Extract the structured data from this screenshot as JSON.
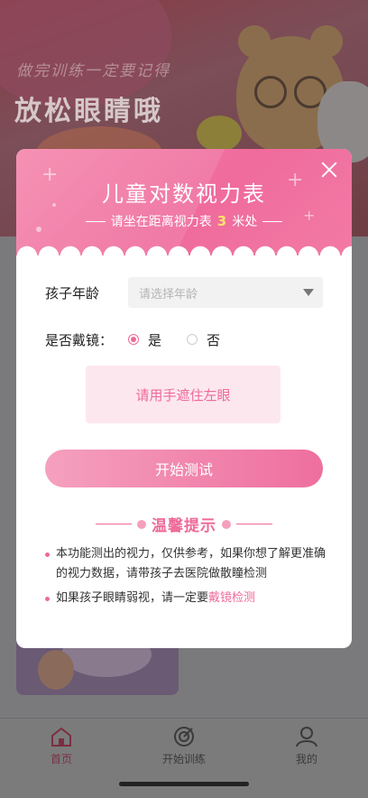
{
  "banner": {
    "subtitle": "做完训练一定要记得",
    "title": "放松眼睛哦"
  },
  "modal": {
    "title": "儿童对数视力表",
    "subtitle_prefix": "请坐在距离视力表",
    "distance": "3",
    "subtitle_suffix": "米处",
    "age_label": "孩子年龄",
    "age_placeholder": "请选择年龄",
    "glasses_label": "是否戴镜：",
    "glasses_yes": "是",
    "glasses_no": "否",
    "glasses_selected": "是",
    "instruction": "请用手遮住左眼",
    "start_button": "开始测试",
    "tips_title": "温馨提示",
    "tips": [
      "本功能测出的视力，仅供参考，如果你想了解更准确的视力数据，请带孩子去医院做散瞳检测",
      "如果孩子眼睛弱视，请一定要"
    ],
    "tip2_link": "戴镜检测"
  },
  "bottom_nav": {
    "items": [
      {
        "label": "首页",
        "icon": "home-icon",
        "active": true
      },
      {
        "label": "开始训练",
        "icon": "target-icon",
        "active": false
      },
      {
        "label": "我的",
        "icon": "user-icon",
        "active": false
      }
    ]
  },
  "colors": {
    "accent": "#ee6a99",
    "highlight": "#ffe36a"
  }
}
